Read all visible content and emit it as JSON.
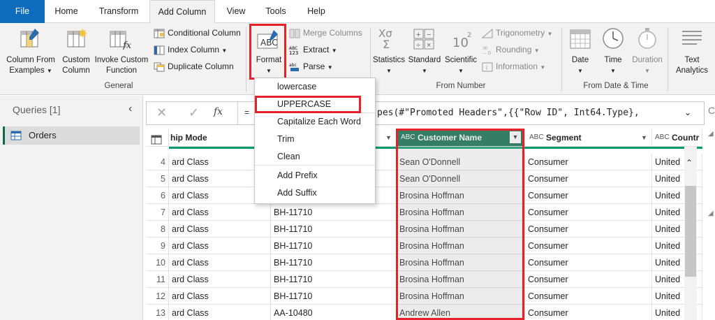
{
  "tabs": [
    {
      "label": "File"
    },
    {
      "label": "Home"
    },
    {
      "label": "Transform"
    },
    {
      "label": "Add Column"
    },
    {
      "label": "View"
    },
    {
      "label": "Tools"
    },
    {
      "label": "Help"
    }
  ],
  "ribbon": {
    "col_from_examples": "Column From",
    "col_from_examples2": "Examples",
    "custom_column": "Custom",
    "custom_column2": "Column",
    "invoke_function": "Invoke Custom",
    "invoke_function2": "Function",
    "conditional_column": "Conditional Column",
    "index_column": "Index Column",
    "duplicate_column": "Duplicate Column",
    "general_group": "General",
    "format": "Format",
    "merge_columns": "Merge Columns",
    "extract": "Extract",
    "parse": "Parse",
    "statistics": "Statistics",
    "standard": "Standard",
    "scientific": "Scientific",
    "trigonometry": "Trigonometry",
    "rounding": "Rounding",
    "information": "Information",
    "from_number_group": "From Number",
    "date": "Date",
    "time": "Time",
    "duration": "Duration",
    "from_datetime_group": "From Date & Time",
    "text_analytics": "Text",
    "text_analytics2": "Analytics"
  },
  "queries": {
    "title": "Queries [1]",
    "items": [
      {
        "label": "Orders"
      }
    ]
  },
  "formula": {
    "fx": "fx",
    "eq": "=",
    "text": "pes(#\"Promoted Headers\",{{\"Row ID\", Int64.Type},"
  },
  "format_menu": {
    "items": [
      "lowercase",
      "UPPERCASE",
      "Capitalize Each Word",
      "Trim",
      "Clean",
      "Add Prefix",
      "Add Suffix"
    ]
  },
  "grid": {
    "headers": {
      "ship_mode": "hip Mode",
      "customer_name": "Customer Name",
      "segment": "Segment",
      "country": "Countr"
    },
    "type_icon": "ABC",
    "rows": [
      {
        "n": "4",
        "ship": "ard Class",
        "id": "",
        "name": "Sean O'Donnell",
        "seg": "Consumer",
        "country": "United"
      },
      {
        "n": "5",
        "ship": "ard Class",
        "id": "",
        "name": "Sean O'Donnell",
        "seg": "Consumer",
        "country": "United"
      },
      {
        "n": "6",
        "ship": "ard Class",
        "id": "",
        "name": "Brosina Hoffman",
        "seg": "Consumer",
        "country": "United"
      },
      {
        "n": "7",
        "ship": "ard Class",
        "id": "BH-11710",
        "name": "Brosina Hoffman",
        "seg": "Consumer",
        "country": "United"
      },
      {
        "n": "8",
        "ship": "ard Class",
        "id": "BH-11710",
        "name": "Brosina Hoffman",
        "seg": "Consumer",
        "country": "United"
      },
      {
        "n": "9",
        "ship": "ard Class",
        "id": "BH-11710",
        "name": "Brosina Hoffman",
        "seg": "Consumer",
        "country": "United"
      },
      {
        "n": "10",
        "ship": "ard Class",
        "id": "BH-11710",
        "name": "Brosina Hoffman",
        "seg": "Consumer",
        "country": "United"
      },
      {
        "n": "11",
        "ship": "ard Class",
        "id": "BH-11710",
        "name": "Brosina Hoffman",
        "seg": "Consumer",
        "country": "United"
      },
      {
        "n": "12",
        "ship": "ard Class",
        "id": "BH-11710",
        "name": "Brosina Hoffman",
        "seg": "Consumer",
        "country": "United"
      },
      {
        "n": "13",
        "ship": "ard Class",
        "id": "AA-10480",
        "name": "Andrew Allen",
        "seg": "Consumer",
        "country": "United"
      }
    ]
  },
  "colors": {
    "accent": "#0f6cbd",
    "selected_header": "#0c6b4d",
    "highlight": "#e8202b"
  }
}
